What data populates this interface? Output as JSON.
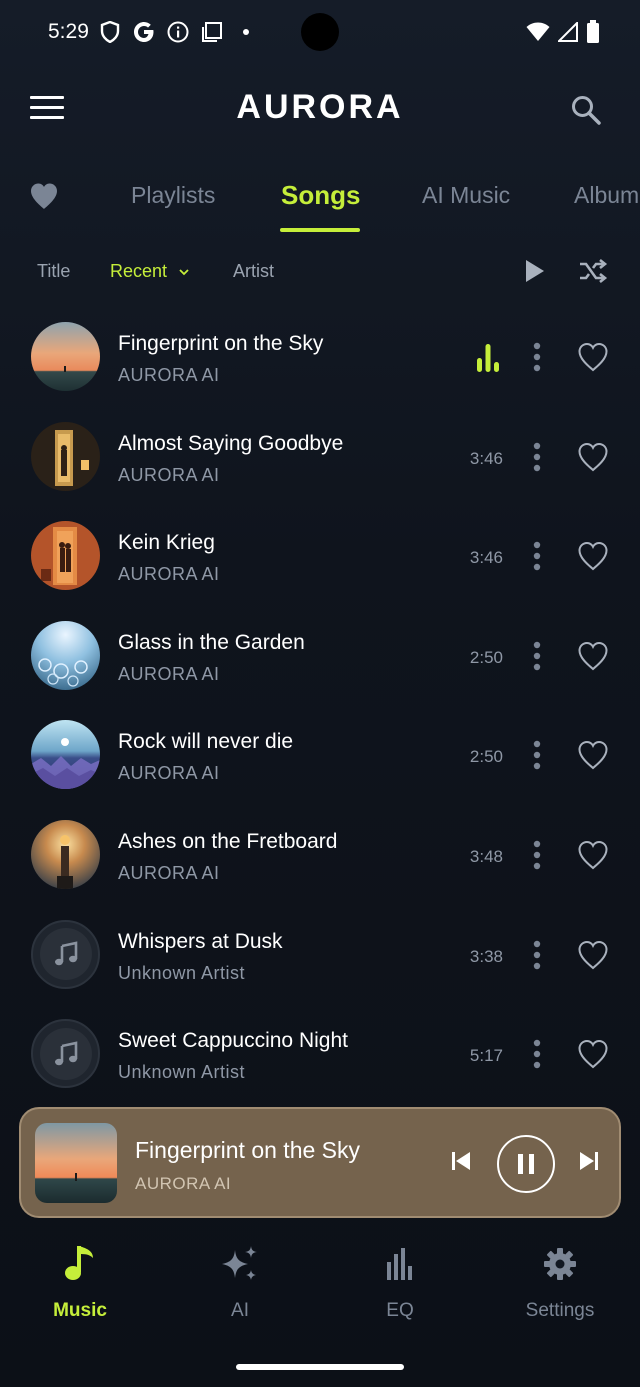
{
  "status_bar": {
    "time": "5:29"
  },
  "header": {
    "logo": "AURORA"
  },
  "tabs": [
    {
      "label": "Playlists"
    },
    {
      "label": "Songs"
    },
    {
      "label": "AI Music"
    },
    {
      "label": "Album"
    }
  ],
  "sort": {
    "title": "Title",
    "recent": "Recent",
    "artist": "Artist"
  },
  "songs": [
    {
      "title": "Fingerprint on the Sky",
      "artist": "AURORA AI",
      "duration": "",
      "playing": true
    },
    {
      "title": "Almost Saying Goodbye",
      "artist": "AURORA AI",
      "duration": "3:46"
    },
    {
      "title": "Kein Krieg",
      "artist": "AURORA AI",
      "duration": "3:46"
    },
    {
      "title": "Glass in the Garden",
      "artist": "AURORA AI",
      "duration": "2:50"
    },
    {
      "title": "Rock will never die",
      "artist": "AURORA AI",
      "duration": "2:50"
    },
    {
      "title": "Ashes on the Fretboard",
      "artist": "AURORA AI",
      "duration": "3:48"
    },
    {
      "title": "Whispers at Dusk",
      "artist": "Unknown Artist",
      "duration": "3:38"
    },
    {
      "title": "Sweet Cappuccino Night",
      "artist": "Unknown Artist",
      "duration": "5:17"
    }
  ],
  "mini_player": {
    "title": "Fingerprint on the Sky",
    "artist": "AURORA AI"
  },
  "bottom_nav": [
    {
      "label": "Music",
      "icon": "music-note-icon",
      "active": true
    },
    {
      "label": "AI",
      "icon": "sparkles-icon"
    },
    {
      "label": "EQ",
      "icon": "equalizer-icon"
    },
    {
      "label": "Settings",
      "icon": "gear-icon"
    }
  ],
  "colors": {
    "accent": "#c5ee3a",
    "background": "#0f141d",
    "mini_player_bg": "#75634d",
    "muted_text": "#8f98a6"
  }
}
